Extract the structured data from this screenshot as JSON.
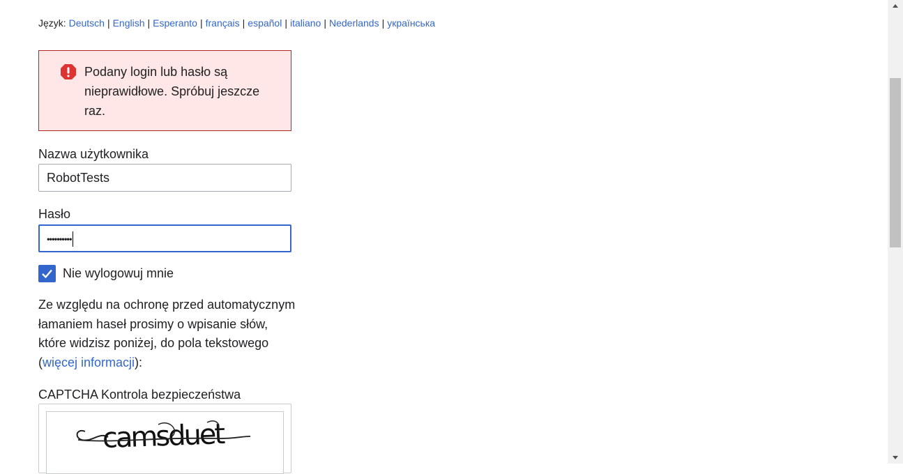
{
  "language_bar": {
    "label": "Język:",
    "languages": [
      "Deutsch",
      "English",
      "Esperanto",
      "français",
      "español",
      "italiano",
      "Nederlands",
      "українська"
    ],
    "separator": "|"
  },
  "error": {
    "icon": "error-icon",
    "message": "Podany login lub hasło są nieprawidłowe. Spróbuj jeszcze raz."
  },
  "username": {
    "label": "Nazwa użytkownika",
    "value": "RobotTests"
  },
  "password": {
    "label": "Hasło",
    "masked_value": "••••••••••"
  },
  "remember": {
    "label": "Nie wylogowuj mnie",
    "checked": true
  },
  "captcha_info": {
    "text_before": "Ze względu na ochronę przed automatycznym łamaniem haseł prosimy o wpisanie słów, które widzisz poniżej, do pola tekstowego (",
    "link": "więcej informacji",
    "text_after": "):"
  },
  "captcha": {
    "label": "CAPTCHA Kontrola bezpieczeństwa",
    "image_text": "camsduet"
  },
  "colors": {
    "link": "#3366cc",
    "error_bg": "#fee7e6",
    "error_border": "#b32424",
    "accent": "#3366cc"
  }
}
